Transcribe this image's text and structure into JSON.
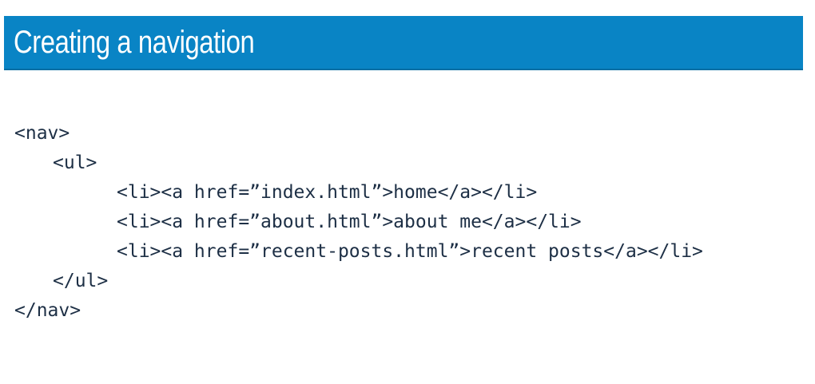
{
  "slide": {
    "title": "Creating a navigation",
    "colors": {
      "title_bar": "#0984c5",
      "title_text": "#ffffff",
      "code_text": "#1d2f45",
      "background": "#ffffff"
    },
    "code_lines": [
      "<nav>",
      "<ul>",
      "<li><a href=”index.html”>home</a></li>",
      "<li><a href=”about.html”>about me</a></li>",
      "<li><a href=”recent-posts.html”>recent posts</a></li>",
      "</ul>",
      "</nav>"
    ]
  }
}
